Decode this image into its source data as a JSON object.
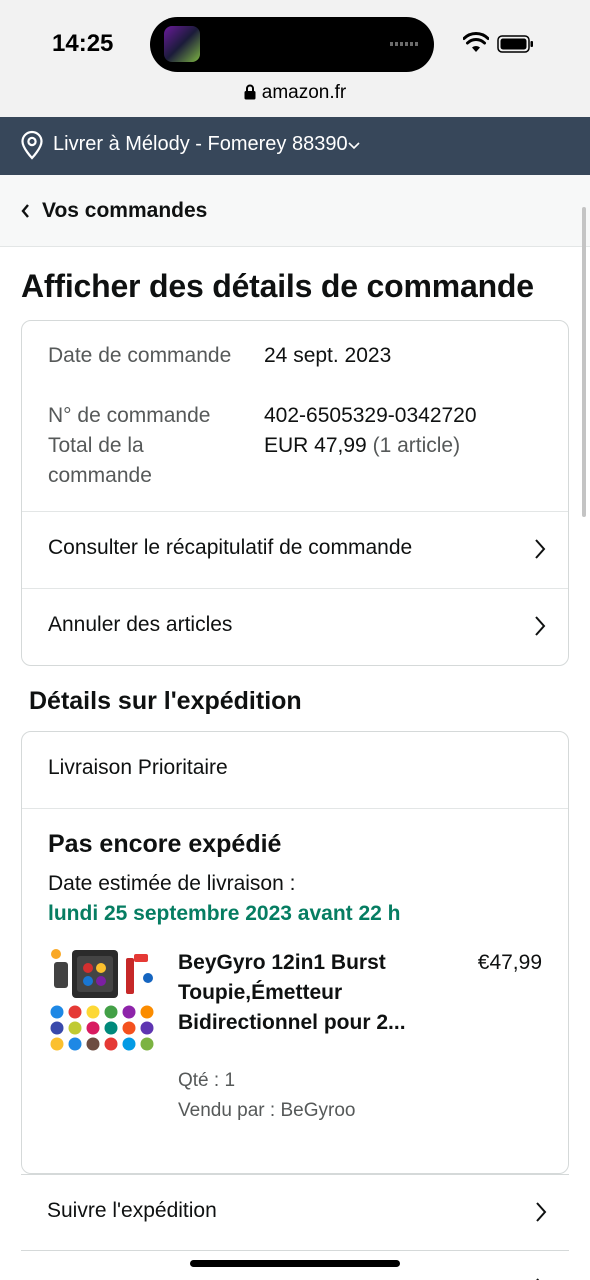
{
  "status_bar": {
    "time": "14:25"
  },
  "browser": {
    "url": "amazon.fr"
  },
  "delivery": {
    "text": "Livrer à Mélody - Fomerey 88390"
  },
  "nav": {
    "back_label": "Vos commandes"
  },
  "page": {
    "title": "Afficher des détails de commande"
  },
  "summary": {
    "date_label": "Date de commande",
    "date_value": "24 sept. 2023",
    "number_label": "N° de commande",
    "number_value": "402-6505329-0342720",
    "total_label": "Total de la commande",
    "total_value": "EUR 47,99",
    "total_count": "(1 article)",
    "links": [
      "Consulter le récapitulatif de commande",
      "Annuler des articles"
    ]
  },
  "shipping": {
    "section_title": "Détails sur l'expédition",
    "method": "Livraison Prioritaire",
    "status": "Pas encore expédié",
    "estimate_label": "Date estimée de livraison :",
    "estimate_date": "lundi 25 septembre 2023 avant 22 h",
    "product": {
      "title": "BeyGyro 12in1 Burst Toupie,Émetteur Bidirectionnel pour 2...",
      "price": "€47,99",
      "quantity": "Qté : 1",
      "seller": "Vendu par : BeGyroo"
    }
  },
  "actions": [
    "Suivre l'expédition"
  ],
  "icons": {
    "location": "location-pin-icon",
    "lock": "lock-icon",
    "wifi": "wifi-icon",
    "battery": "battery-icon",
    "back": "chevron-left-icon",
    "chevron": "chevron-right-icon",
    "dropdown": "chevron-down-icon"
  },
  "colors": {
    "delivery_bar": "#37475a",
    "estimate_green": "#067d62",
    "text": "#0f1111",
    "muted": "#565959",
    "border": "#d5d9d9"
  }
}
